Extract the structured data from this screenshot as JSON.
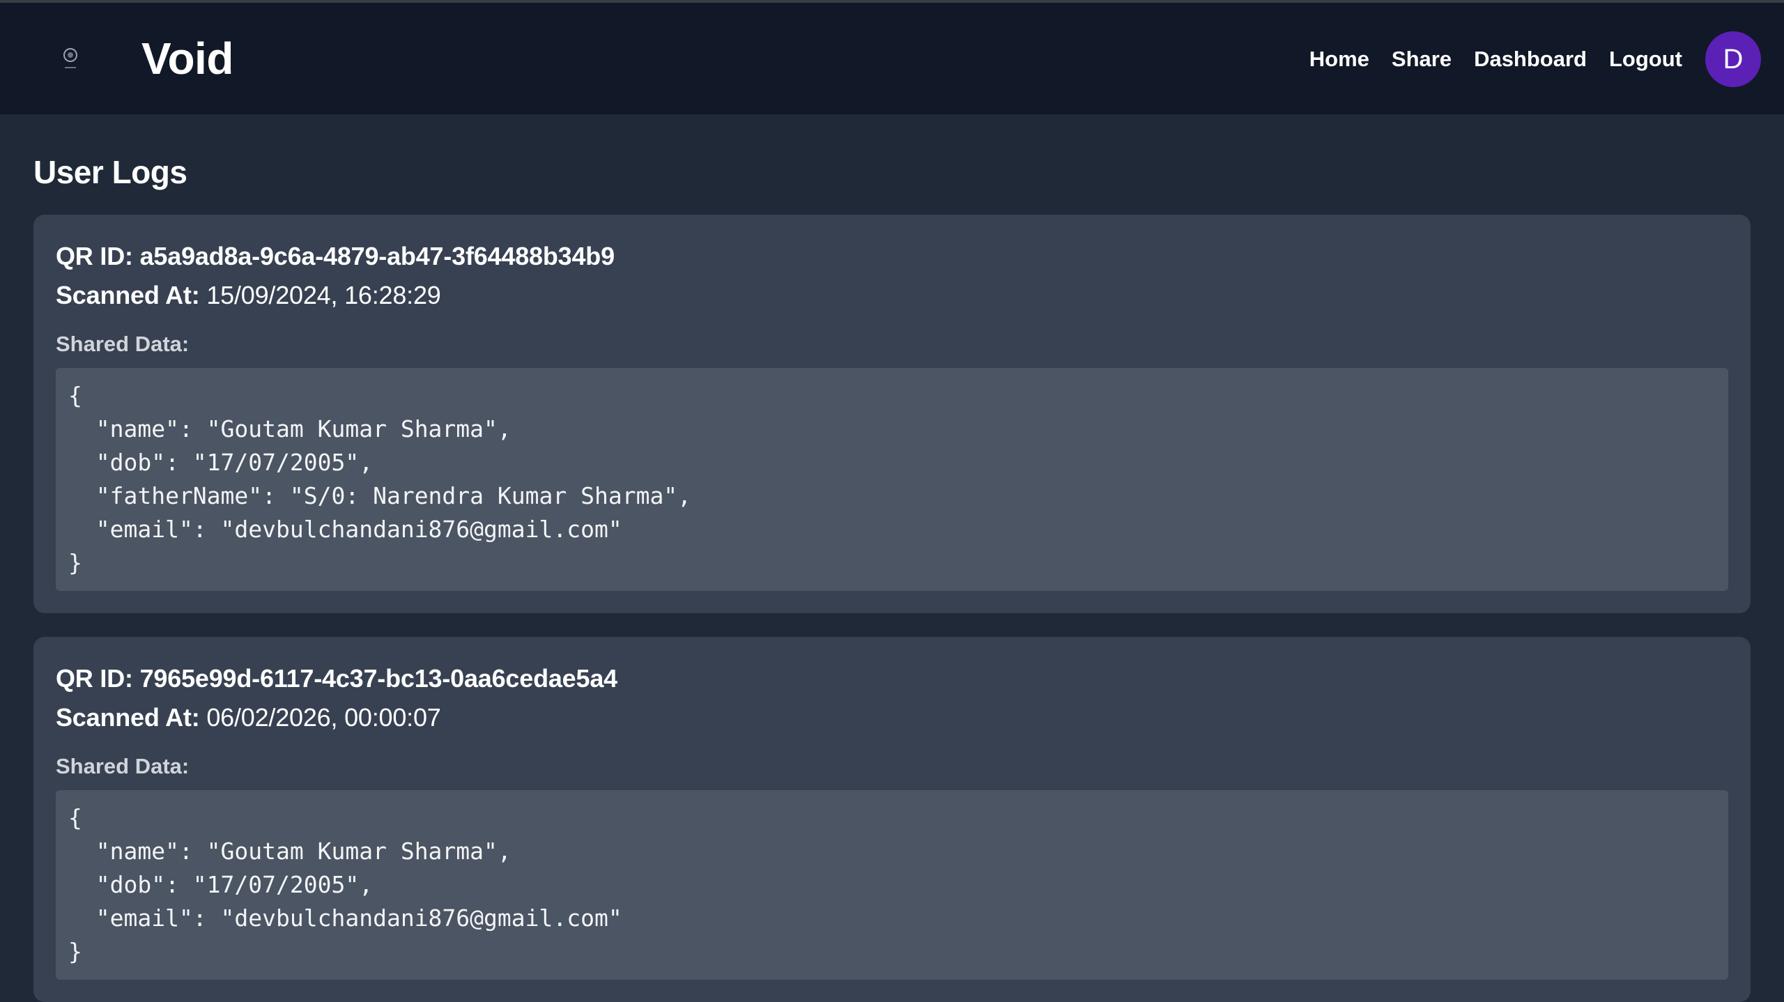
{
  "header": {
    "brand": "Void",
    "nav": [
      "Home",
      "Share",
      "Dashboard",
      "Logout"
    ],
    "avatar_initial": "D",
    "colors": {
      "nav_bg": "#111827",
      "avatar_bg": "#5b21b6"
    }
  },
  "page": {
    "title": "User Logs"
  },
  "logs": [
    {
      "qr_label": "QR ID:",
      "qr_id": "a5a9ad8a-9c6a-4879-ab47-3f64488b34b9",
      "scanned_label": "Scanned At:",
      "scanned_at": "15/09/2024, 16:28:29",
      "shared_label": "Shared Data:",
      "shared_data": "{\n  \"name\": \"Goutam Kumar Sharma\",\n  \"dob\": \"17/07/2005\",\n  \"fatherName\": \"S/0: Narendra Kumar Sharma\",\n  \"email\": \"devbulchandani876@gmail.com\"\n}"
    },
    {
      "qr_label": "QR ID:",
      "qr_id": "7965e99d-6117-4c37-bc13-0aa6cedae5a4",
      "scanned_label": "Scanned At:",
      "scanned_at": "06/02/2026, 00:00:07",
      "shared_label": "Shared Data:",
      "shared_data": "{\n  \"name\": \"Goutam Kumar Sharma\",\n  \"dob\": \"17/07/2005\",\n  \"email\": \"devbulchandani876@gmail.com\"\n}"
    }
  ]
}
